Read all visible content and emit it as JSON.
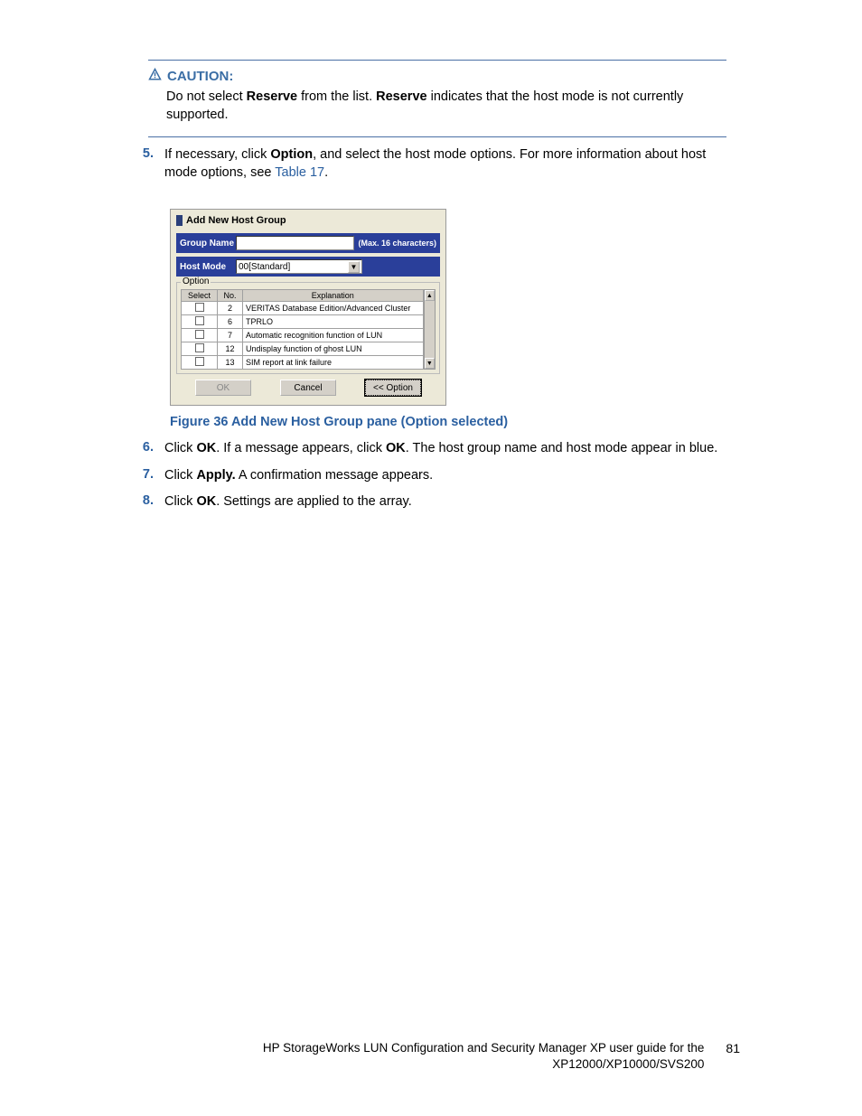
{
  "caution": {
    "label": "CAUTION:",
    "text_parts": [
      "Do not select ",
      "Reserve",
      " from the list. ",
      "Reserve",
      " indicates that the host mode is not currently supported."
    ]
  },
  "steps": {
    "s5": {
      "num": "5.",
      "parts": [
        "If necessary, click ",
        "Option",
        ", and select the host mode options.  For more information about host mode options, see "
      ],
      "link": "Table 17",
      "tail": "."
    },
    "s6": {
      "num": "6.",
      "parts": [
        "Click ",
        "OK",
        ". If a message appears, click ",
        "OK",
        ". The host group name and host mode appear in blue."
      ]
    },
    "s7": {
      "num": "7.",
      "parts": [
        "Click ",
        "Apply.",
        " A confirmation message appears."
      ]
    },
    "s8": {
      "num": "8.",
      "parts": [
        "Click ",
        "OK",
        ". Settings are applied to the array."
      ]
    }
  },
  "screenshot": {
    "title": "Add New Host Group",
    "group_name_label": "Group Name",
    "group_name_hint": "(Max. 16 characters)",
    "host_mode_label": "Host Mode",
    "host_mode_value": "00[Standard]",
    "option_label": "Option",
    "columns": {
      "select": "Select",
      "no": "No.",
      "explanation": "Explanation"
    },
    "rows": [
      {
        "no": "2",
        "exp": "VERITAS Database Edition/Advanced Cluster"
      },
      {
        "no": "6",
        "exp": "TPRLO"
      },
      {
        "no": "7",
        "exp": "Automatic recognition function of LUN"
      },
      {
        "no": "12",
        "exp": "Undisplay function of ghost LUN"
      },
      {
        "no": "13",
        "exp": "SIM report at link failure"
      }
    ],
    "buttons": {
      "ok": "OK",
      "cancel": "Cancel",
      "option": "<< Option"
    }
  },
  "figure_caption": "Figure 36 Add New Host Group pane (Option selected)",
  "footer": {
    "line1": "HP StorageWorks LUN Configuration and Security Manager XP user guide for the",
    "line2": "XP12000/XP10000/SVS200",
    "page": "81"
  }
}
